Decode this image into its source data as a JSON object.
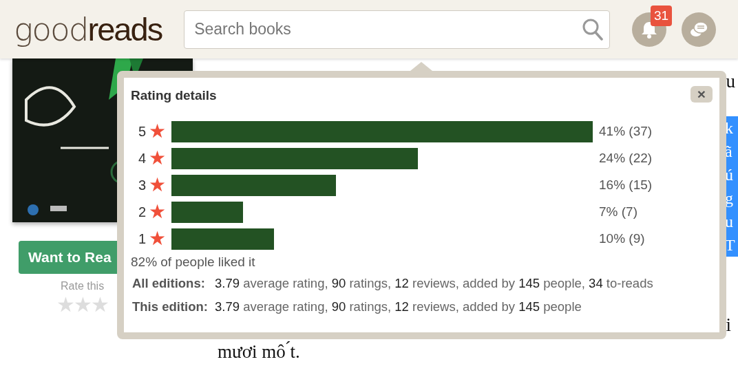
{
  "header": {
    "logo": {
      "light": "good",
      "dark": "reads"
    },
    "search": {
      "placeholder": "Search books"
    },
    "notifications": {
      "count": "31"
    }
  },
  "book": {
    "want_button": "Want to Rea",
    "rate_label": "Rate this",
    "rate_stars": "★★★"
  },
  "description": {
    "fragments": [
      "u",
      "i"
    ],
    "highlighted": [
      "k",
      "ã",
      "ú",
      "g",
      "u",
      "T"
    ],
    "last_line": "mươi mô ́t."
  },
  "rating_details": {
    "title": "Rating details",
    "close": "×",
    "rows": [
      {
        "stars": "5",
        "star_glyph": "★",
        "reading": "41% (37)"
      },
      {
        "stars": "4",
        "star_glyph": "★",
        "reading": "24% (22)"
      },
      {
        "stars": "3",
        "star_glyph": "★",
        "reading": "16% (15)"
      },
      {
        "stars": "2",
        "star_glyph": "★",
        "reading": "7% (7)"
      },
      {
        "stars": "1",
        "star_glyph": "★",
        "reading": "10% (9)"
      }
    ],
    "liked": "82% of people liked it",
    "editions": [
      {
        "label": "All editions:",
        "parts": [
          {
            "text": "3.79",
            "emphasis": true
          },
          {
            "text": " average rating, ",
            "emphasis": false
          },
          {
            "text": "90",
            "emphasis": true
          },
          {
            "text": " ratings, ",
            "emphasis": false
          },
          {
            "text": "12",
            "emphasis": true
          },
          {
            "text": " reviews, added by ",
            "emphasis": false
          },
          {
            "text": "145",
            "emphasis": true
          },
          {
            "text": " people, ",
            "emphasis": false
          },
          {
            "text": "34",
            "emphasis": true
          },
          {
            "text": " to-reads",
            "emphasis": false
          }
        ]
      },
      {
        "label": "This edition:",
        "parts": [
          {
            "text": "3.79",
            "emphasis": true
          },
          {
            "text": " average rating, ",
            "emphasis": false
          },
          {
            "text": "90",
            "emphasis": true
          },
          {
            "text": " ratings, ",
            "emphasis": false
          },
          {
            "text": "12",
            "emphasis": true
          },
          {
            "text": " reviews, added by ",
            "emphasis": false
          },
          {
            "text": "145",
            "emphasis": true
          },
          {
            "text": " people",
            "emphasis": false
          }
        ]
      }
    ]
  }
}
